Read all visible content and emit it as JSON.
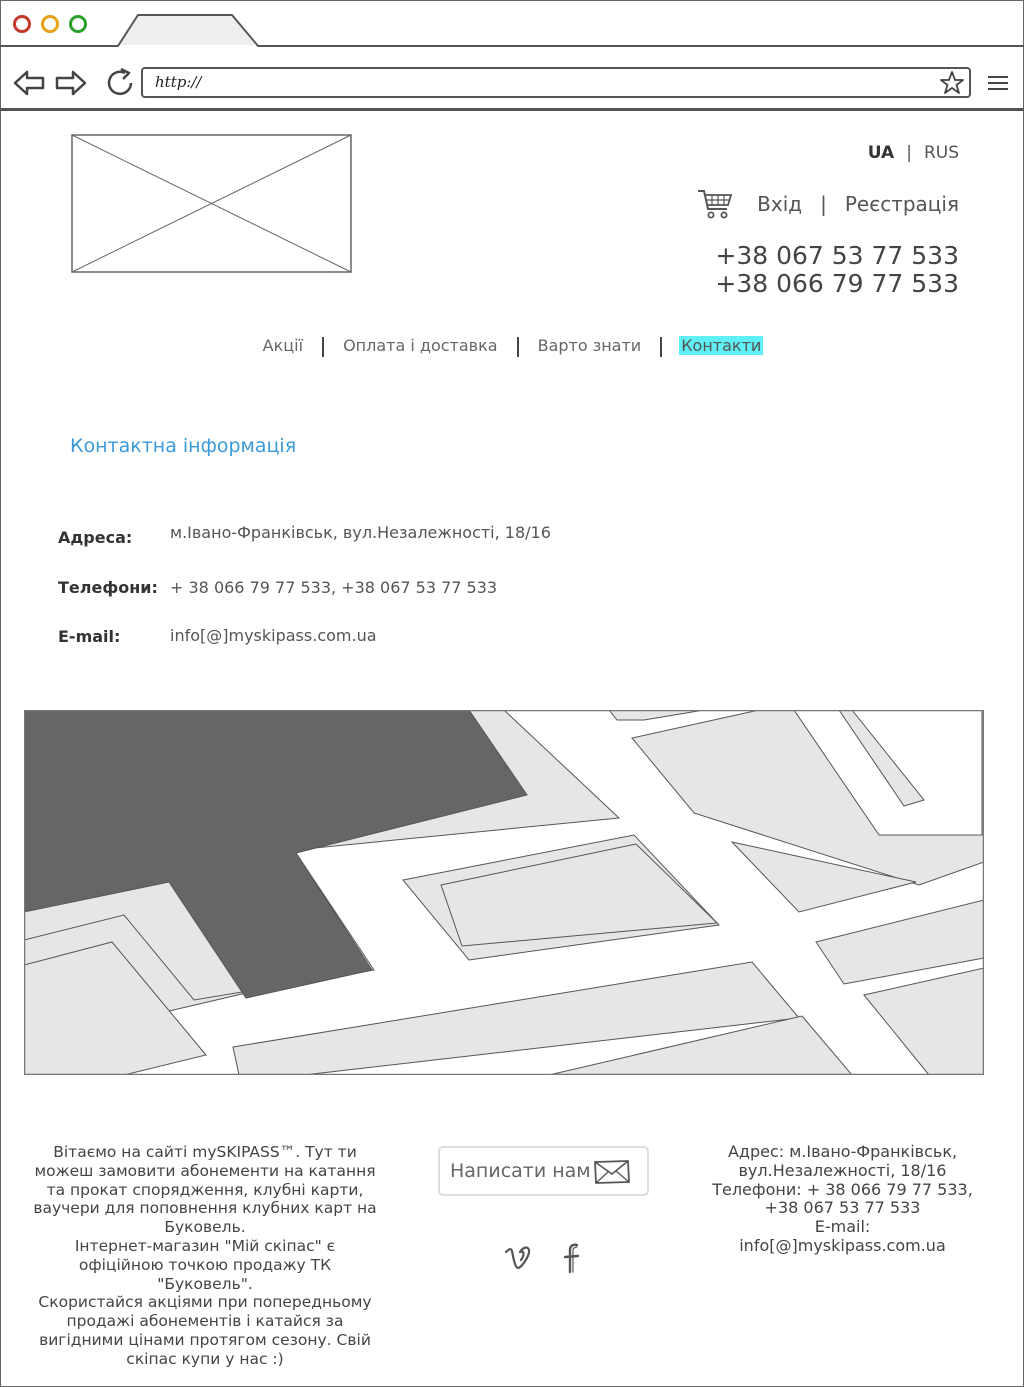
{
  "browser": {
    "url": "http://",
    "colors": {
      "close": "#c0392b",
      "minimize": "#e6a118",
      "maximize": "#2ca02c"
    }
  },
  "header": {
    "lang_ua": "UA",
    "lang_sep": "|",
    "lang_rus": "RUS",
    "login": "Вхід",
    "account_sep": "|",
    "register": "Реєстрація",
    "phone1": "+38 067 53 77 533",
    "phone2": "+38 066 79 77 533"
  },
  "menu": {
    "items": [
      "Акції",
      "Оплата і доставка",
      "Варто знати",
      "Контакти"
    ],
    "active_index": 3,
    "active_color": "#5ff0f5"
  },
  "contacts": {
    "title": "Контактна інформація",
    "address_label": "Адреса:",
    "address_value": "м.Івано-Франківськ, вул.Незалежності, 18/16",
    "phones_label": "Телефони:",
    "phones_value": "+  38 066 79 77 533, +38 067 53 77 533",
    "email_label": "E-mail:",
    "email_value": "info[@]myskipass.com.ua",
    "title_color": "#3a9ad9"
  },
  "footer": {
    "about_lines": [
      "Вітаємо на сайті mySKIPASS™. Тут ти",
      "можеш замовити абонементи на катання",
      "та прокат спорядження, клубні карти,",
      "ваучери для поповнення клубних карт на",
      "Буковель.",
      "Інтернет-магазин \"Мій скіпас\" є",
      "офіційною точкою продажу ТК \"Буковель\".",
      "Скористайся акціями при попередньому",
      "продажі абонементів і катайся за",
      "вигідними цінами протягом сезону. Свій",
      "скіпас купи у нас :)"
    ],
    "write_us": "Написати нам",
    "contact_lines": [
      "Адрес: м.Івано-Франківськ,",
      "вул.Незалежності, 18/16",
      "Телефони: + 38 066 79 77 533,",
      "+38 067 53 77 533",
      "E-mail:",
      "info[@]myskipass.com.ua"
    ]
  },
  "icons": {
    "back": "arrow-left-icon",
    "forward": "arrow-right-icon",
    "reload": "reload-icon",
    "bookmark": "star-icon",
    "menu": "hamburger-icon",
    "cart": "cart-icon",
    "mail": "envelope-icon",
    "vimeo": "vimeo-icon",
    "facebook": "facebook-icon"
  }
}
